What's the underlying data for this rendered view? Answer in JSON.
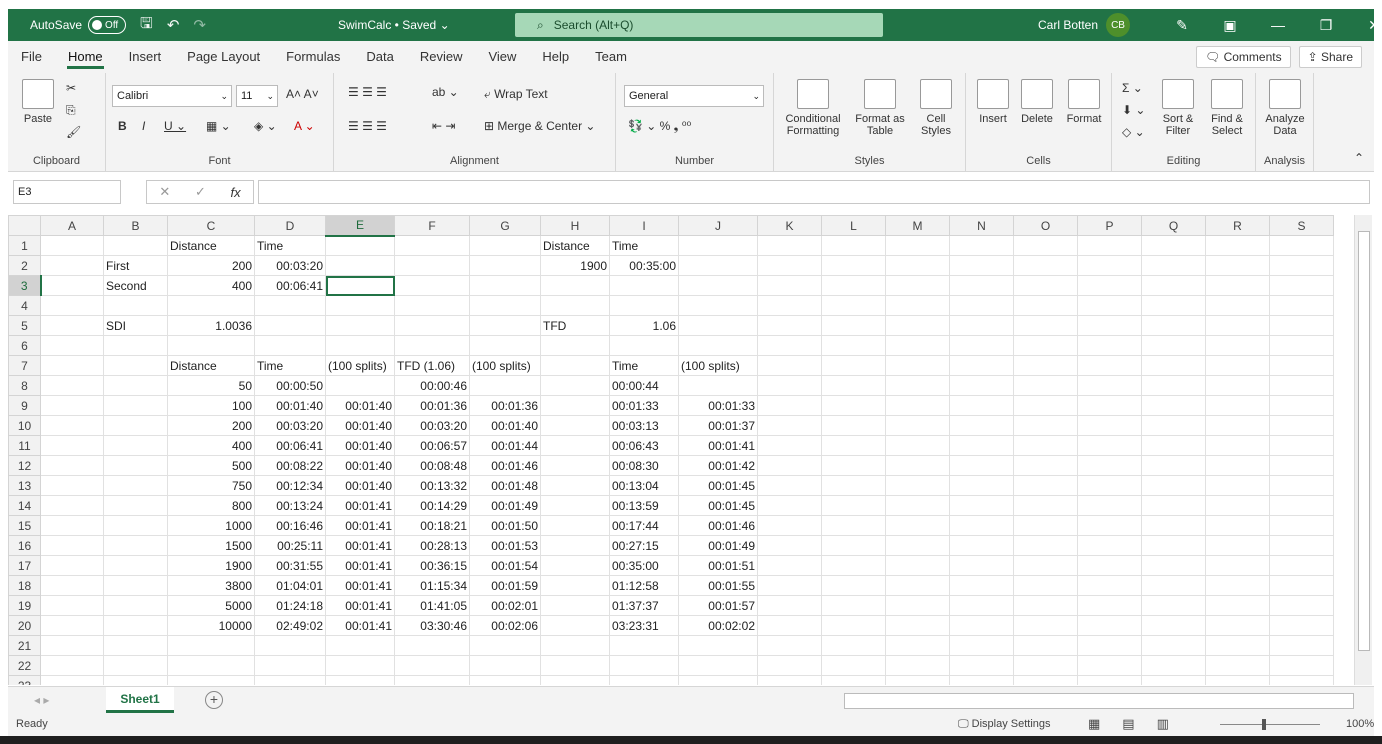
{
  "titlebar": {
    "autosave_label": "AutoSave",
    "autosave_state": "Off",
    "doc_name": "SwimCalc • Saved ⌄",
    "search_placeholder": "Search (Alt+Q)",
    "user_name": "Carl Botten",
    "user_initials": "CB"
  },
  "ribbon_tabs": [
    "File",
    "Home",
    "Insert",
    "Page Layout",
    "Formulas",
    "Data",
    "Review",
    "View",
    "Help",
    "Team"
  ],
  "ribbon_actions": {
    "comments": "Comments",
    "share": "Share"
  },
  "ribbon": {
    "clipboard": {
      "paste": "Paste",
      "label": "Clipboard"
    },
    "font": {
      "name": "Calibri",
      "size": "11",
      "label": "Font"
    },
    "alignment": {
      "wrap": "Wrap Text",
      "merge": "Merge & Center",
      "label": "Alignment"
    },
    "number": {
      "format": "General",
      "label": "Number"
    },
    "styles": {
      "conditional": "Conditional Formatting",
      "format_table": "Format as Table",
      "cell_styles": "Cell Styles",
      "label": "Styles"
    },
    "cells": {
      "insert": "Insert",
      "delete": "Delete",
      "format": "Format",
      "label": "Cells"
    },
    "editing": {
      "sort": "Sort & Filter",
      "find": "Find & Select",
      "label": "Editing"
    },
    "analysis": {
      "analyze": "Analyze Data",
      "label": "Analysis"
    }
  },
  "formula_bar": {
    "name_box": "E3",
    "formula": ""
  },
  "columns": [
    "A",
    "B",
    "C",
    "D",
    "E",
    "F",
    "G",
    "H",
    "I",
    "J",
    "K",
    "L",
    "M",
    "N",
    "O",
    "P",
    "Q",
    "R",
    "S"
  ],
  "selected_column": "E",
  "selected_row": 3,
  "rows": [
    [
      "",
      "",
      "Distance",
      "Time",
      "",
      "",
      "",
      "Distance",
      "Time",
      "",
      "",
      "",
      "",
      "",
      "",
      "",
      "",
      "",
      ""
    ],
    [
      "",
      "First",
      "200",
      "00:03:20",
      "",
      "",
      "",
      "1900",
      "00:35:00",
      "",
      "",
      "",
      "",
      "",
      "",
      "",
      "",
      "",
      ""
    ],
    [
      "",
      "Second",
      "400",
      "00:06:41",
      "",
      "",
      "",
      "",
      "",
      "",
      "",
      "",
      "",
      "",
      "",
      "",
      "",
      "",
      ""
    ],
    [
      "",
      "",
      "",
      "",
      "",
      "",
      "",
      "",
      "",
      "",
      "",
      "",
      "",
      "",
      "",
      "",
      "",
      "",
      ""
    ],
    [
      "",
      "SDI",
      "1.0036",
      "",
      "",
      "",
      "",
      "TFD",
      "1.06",
      "",
      "",
      "",
      "",
      "",
      "",
      "",
      "",
      "",
      ""
    ],
    [
      "",
      "",
      "",
      "",
      "",
      "",
      "",
      "",
      "",
      "",
      "",
      "",
      "",
      "",
      "",
      "",
      "",
      "",
      ""
    ],
    [
      "",
      "",
      "Distance",
      "Time",
      "(100 splits)",
      "TFD (1.06)",
      "(100 splits)",
      "",
      "Time",
      "(100 splits)",
      "",
      "",
      "",
      "",
      "",
      "",
      "",
      "",
      ""
    ],
    [
      "",
      "",
      "50",
      "00:00:50",
      "",
      "00:00:46",
      "",
      "",
      "00:00:44",
      "",
      "",
      "",
      "",
      "",
      "",
      "",
      "",
      "",
      ""
    ],
    [
      "",
      "",
      "100",
      "00:01:40",
      "00:01:40",
      "00:01:36",
      "00:01:36",
      "",
      "00:01:33",
      "00:01:33",
      "",
      "",
      "",
      "",
      "",
      "",
      "",
      "",
      ""
    ],
    [
      "",
      "",
      "200",
      "00:03:20",
      "00:01:40",
      "00:03:20",
      "00:01:40",
      "",
      "00:03:13",
      "00:01:37",
      "",
      "",
      "",
      "",
      "",
      "",
      "",
      "",
      ""
    ],
    [
      "",
      "",
      "400",
      "00:06:41",
      "00:01:40",
      "00:06:57",
      "00:01:44",
      "",
      "00:06:43",
      "00:01:41",
      "",
      "",
      "",
      "",
      "",
      "",
      "",
      "",
      ""
    ],
    [
      "",
      "",
      "500",
      "00:08:22",
      "00:01:40",
      "00:08:48",
      "00:01:46",
      "",
      "00:08:30",
      "00:01:42",
      "",
      "",
      "",
      "",
      "",
      "",
      "",
      "",
      ""
    ],
    [
      "",
      "",
      "750",
      "00:12:34",
      "00:01:40",
      "00:13:32",
      "00:01:48",
      "",
      "00:13:04",
      "00:01:45",
      "",
      "",
      "",
      "",
      "",
      "",
      "",
      "",
      ""
    ],
    [
      "",
      "",
      "800",
      "00:13:24",
      "00:01:41",
      "00:14:29",
      "00:01:49",
      "",
      "00:13:59",
      "00:01:45",
      "",
      "",
      "",
      "",
      "",
      "",
      "",
      "",
      ""
    ],
    [
      "",
      "",
      "1000",
      "00:16:46",
      "00:01:41",
      "00:18:21",
      "00:01:50",
      "",
      "00:17:44",
      "00:01:46",
      "",
      "",
      "",
      "",
      "",
      "",
      "",
      "",
      ""
    ],
    [
      "",
      "",
      "1500",
      "00:25:11",
      "00:01:41",
      "00:28:13",
      "00:01:53",
      "",
      "00:27:15",
      "00:01:49",
      "",
      "",
      "",
      "",
      "",
      "",
      "",
      "",
      ""
    ],
    [
      "",
      "",
      "1900",
      "00:31:55",
      "00:01:41",
      "00:36:15",
      "00:01:54",
      "",
      "00:35:00",
      "00:01:51",
      "",
      "",
      "",
      "",
      "",
      "",
      "",
      "",
      ""
    ],
    [
      "",
      "",
      "3800",
      "01:04:01",
      "00:01:41",
      "01:15:34",
      "00:01:59",
      "",
      "01:12:58",
      "00:01:55",
      "",
      "",
      "",
      "",
      "",
      "",
      "",
      "",
      ""
    ],
    [
      "",
      "",
      "5000",
      "01:24:18",
      "00:01:41",
      "01:41:05",
      "00:02:01",
      "",
      "01:37:37",
      "00:01:57",
      "",
      "",
      "",
      "",
      "",
      "",
      "",
      "",
      ""
    ],
    [
      "",
      "",
      "10000",
      "02:49:02",
      "00:01:41",
      "03:30:46",
      "00:02:06",
      "",
      "03:23:31",
      "00:02:02",
      "",
      "",
      "",
      "",
      "",
      "",
      "",
      "",
      ""
    ],
    [
      "",
      "",
      "",
      "",
      "",
      "",
      "",
      "",
      "",
      "",
      "",
      "",
      "",
      "",
      "",
      "",
      "",
      "",
      ""
    ],
    [
      "",
      "",
      "",
      "",
      "",
      "",
      "",
      "",
      "",
      "",
      "",
      "",
      "",
      "",
      "",
      "",
      "",
      "",
      ""
    ],
    [
      "",
      "",
      "",
      "",
      "",
      "",
      "",
      "",
      "",
      "",
      "",
      "",
      "",
      "",
      "",
      "",
      "",
      "",
      ""
    ]
  ],
  "sheets": [
    "Sheet1"
  ],
  "status": {
    "ready": "Ready",
    "display_settings": "Display Settings",
    "zoom": "100%"
  }
}
